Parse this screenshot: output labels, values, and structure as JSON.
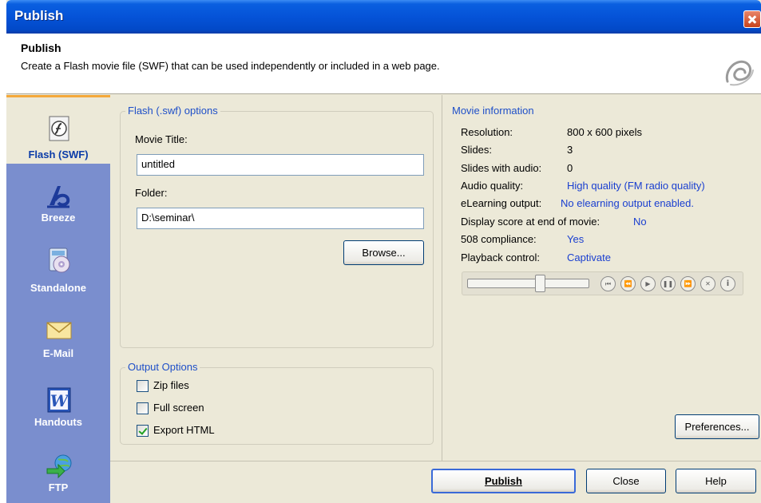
{
  "window": {
    "title": "Publish"
  },
  "header": {
    "title": "Publish",
    "description": "Create a Flash movie file (SWF) that can be used independently or included in a web page."
  },
  "sidebar": {
    "items": [
      {
        "label": "Flash (SWF)",
        "icon": "flash-icon",
        "selected": true
      },
      {
        "label": "Breeze",
        "icon": "breeze-icon"
      },
      {
        "label": "Standalone",
        "icon": "standalone-cd-icon"
      },
      {
        "label": "E-Mail",
        "icon": "email-envelope-icon"
      },
      {
        "label": "Handouts",
        "icon": "word-document-icon"
      },
      {
        "label": "FTP",
        "icon": "ftp-transfer-icon"
      }
    ]
  },
  "flash_options": {
    "title": "Flash (.swf) options",
    "movie_title_label": "Movie Title:",
    "movie_title_value": "untitled",
    "folder_label": "Folder:",
    "folder_value": "D:\\seminar\\",
    "browse_label": "Browse..."
  },
  "output_options": {
    "title": "Output Options",
    "zip_label": "Zip files",
    "zip_checked": false,
    "fullscreen_label": "Full screen",
    "fullscreen_checked": false,
    "export_html_label": "Export HTML",
    "export_html_checked": true
  },
  "movie_info": {
    "title": "Movie information",
    "resolution_label": "Resolution:",
    "resolution_value": "800 x 600 pixels",
    "slides_label": "Slides:",
    "slides_value": "3",
    "slides_audio_label": "Slides with audio:",
    "slides_audio_value": "0",
    "audio_quality_label": "Audio quality:",
    "audio_quality_value": "High quality (FM radio quality)",
    "elearning_label": "eLearning output:",
    "elearning_value": "No elearning output enabled.",
    "display_score_label": "Display score at end of movie:",
    "display_score_value": "No",
    "compliance_label": "508 compliance:",
    "compliance_value": "Yes",
    "playback_label": "Playback control:",
    "playback_value": "Captivate",
    "preferences_label": "Preferences..."
  },
  "footer": {
    "publish_label": "Publish",
    "close_label": "Close",
    "help_label": "Help"
  },
  "colors": {
    "titlebar": "#0553d8",
    "sidebar": "#7a8ece",
    "accent_text": "#1a3fd0",
    "selected_tab_border": "#f4a83a"
  }
}
